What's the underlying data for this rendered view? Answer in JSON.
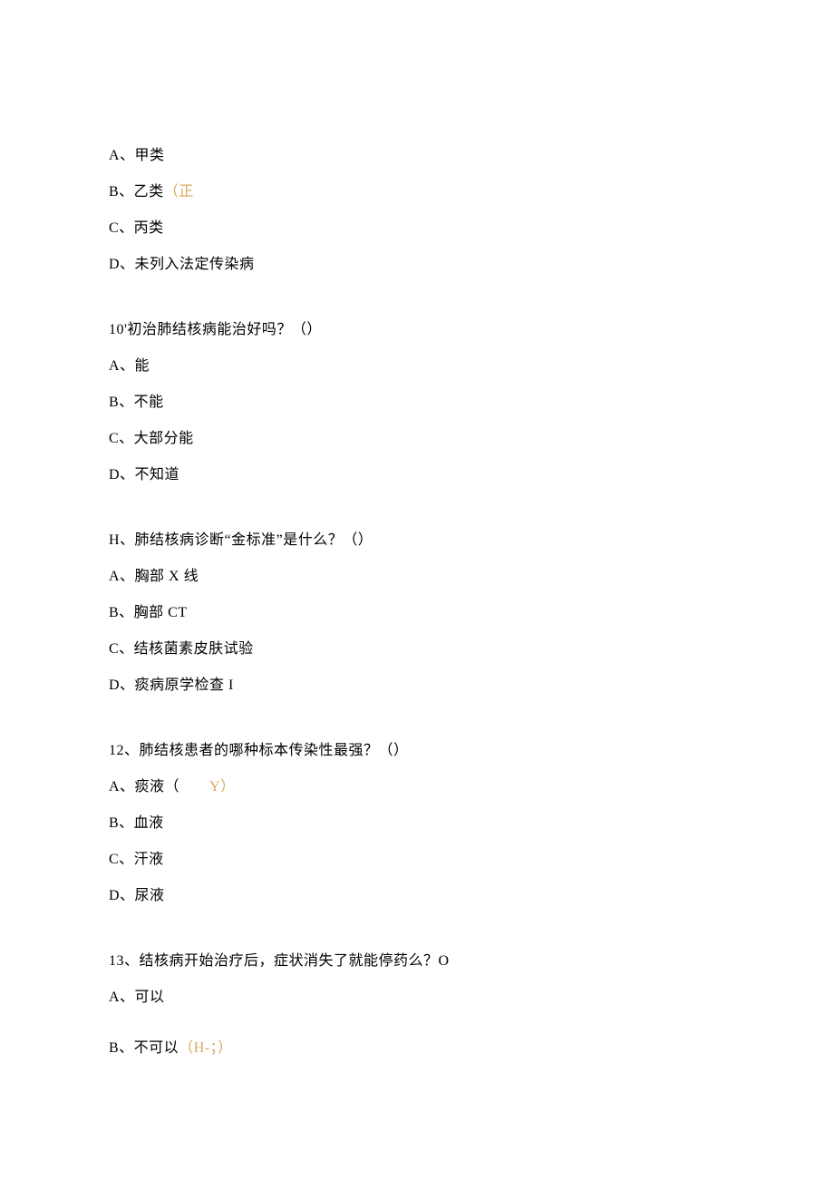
{
  "q9_options": {
    "a": "A、甲类",
    "b_prefix": "B、乙类",
    "b_ann": "（正",
    "c": "C、丙类",
    "d": "D、未列入法定传染病"
  },
  "q10": {
    "stem": "10'初治肺结核病能治好吗？（）",
    "a": "A、能",
    "b": "B、不能",
    "c": "C、大部分能",
    "d": "D、不知道"
  },
  "q11": {
    "stem": "H、肺结核病诊断“金标准”是什么？（）",
    "a": "A、胸部 X 线",
    "b": "B、胸部 CT",
    "c": "C、结核菌素皮肤试验",
    "d": "D、痰病原学检查 I"
  },
  "q12": {
    "stem": "12、肺结核患者的哪种标本传染性最强？（）",
    "a_prefix": "A、痰液（",
    "a_ann": "　　Y）",
    "b": "B、血液",
    "c": "C、汗液",
    "d": "D、尿液"
  },
  "q13": {
    "stem": "13、结核病开始治疗后，症状消失了就能停药么？O",
    "a": "A、可以",
    "b_prefix": "B、不可以",
    "b_ann": "（H-；）"
  }
}
